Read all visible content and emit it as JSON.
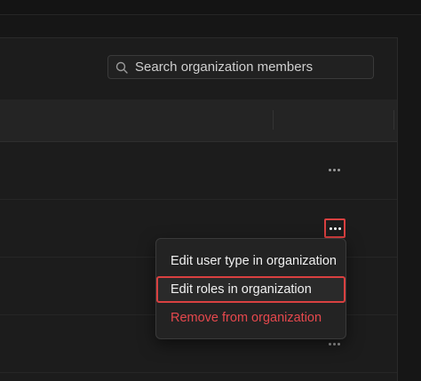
{
  "search": {
    "placeholder": "Search organization members",
    "value": ""
  },
  "rows": [
    {
      "actions_icon": "more-horizontal-icon"
    },
    {
      "actions_icon": "more-horizontal-icon",
      "active": true
    },
    {
      "actions_icon": "more-horizontal-icon"
    },
    {
      "actions_icon": "more-horizontal-icon"
    }
  ],
  "menu": {
    "items": [
      {
        "label": "Edit user type in organization"
      },
      {
        "label": "Edit roles in organization"
      },
      {
        "label": "Remove from organization"
      }
    ]
  },
  "colors": {
    "danger": "#e5484d",
    "highlight_border": "#d94040",
    "background": "#161616"
  }
}
